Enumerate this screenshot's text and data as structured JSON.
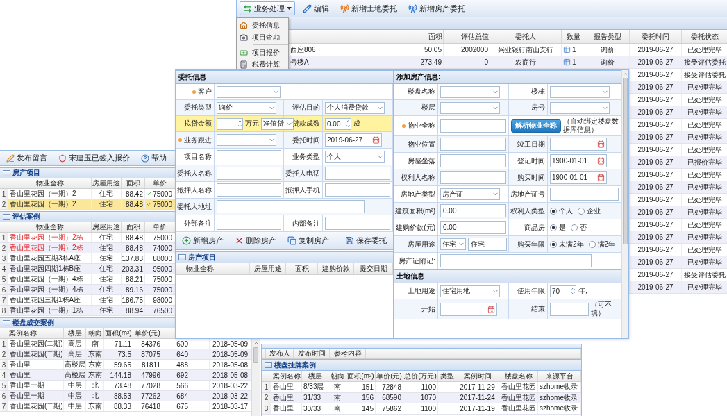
{
  "main_window": {
    "toolbar": [
      {
        "kind": "dropdown",
        "label": "业务处理"
      },
      {
        "kind": "edit",
        "label": "编辑"
      },
      {
        "kind": "land",
        "label": "新增土地委托"
      },
      {
        "kind": "house",
        "label": "新增房产委托"
      }
    ],
    "menu": [
      {
        "kind": "info",
        "label": "委托信息",
        "separator_before": false
      },
      {
        "kind": "survey",
        "label": "项目查勘",
        "separator_before": false
      },
      {
        "kind": "quote",
        "label": "项目报价",
        "separator_before": true
      },
      {
        "kind": "tax",
        "label": "税费计算",
        "separator_before": false
      }
    ],
    "columns": [
      "面积",
      "评估总值",
      "委托人",
      "数量",
      "报告类型",
      "委托时间",
      "委托状态"
    ],
    "rows": [
      {
        "name": "西座806",
        "area": "50.05",
        "value": "2002000",
        "client": "兴业银行南山支行",
        "count": "1",
        "report": "询价",
        "date": "2019-06-27",
        "status": "已处理完毕"
      },
      {
        "name": "号楼A",
        "area": "273.49",
        "value": "0",
        "client": "农商行",
        "count": "1",
        "report": "询价",
        "date": "2019-06-27",
        "status": "接受评估委托"
      },
      {
        "date": "2019-06-27",
        "status": "接受评估委托"
      },
      {
        "date": "2019-06-27",
        "status": "已处理完毕"
      },
      {
        "date": "2019-06-27",
        "status": "已处理完毕"
      },
      {
        "date": "2019-06-27",
        "status": "已处理完毕"
      },
      {
        "date": "2019-06-27",
        "status": "已处理完毕"
      },
      {
        "date": "2019-06-27",
        "status": "已处理完毕"
      },
      {
        "date": "2019-06-27",
        "status": "已处理完毕"
      },
      {
        "date": "2019-06-27",
        "status": "已报价完毕"
      },
      {
        "date": "2019-06-27",
        "status": "已处理完毕"
      },
      {
        "date": "2019-06-27",
        "status": "已处理完毕"
      },
      {
        "date": "2019-06-27",
        "status": "已处理完毕"
      },
      {
        "date": "2019-06-27",
        "status": "已处理完毕"
      },
      {
        "date": "2019-06-27",
        "status": "已处理完毕"
      },
      {
        "date": "2019-06-27",
        "status": "已处理完毕"
      },
      {
        "date": "2019-06-27",
        "status": "已处理完毕"
      },
      {
        "date": "2019-06-27",
        "status": "已处理完毕"
      },
      {
        "date": "2019-06-27",
        "status": "接受评估委托"
      },
      {
        "date": "2019-06-27",
        "status": "已处理完毕"
      }
    ]
  },
  "left_window": {
    "toolbar": [
      {
        "kind": "message",
        "label": "发布留言"
      },
      {
        "kind": "shield",
        "label": "宋建玉已签入报价"
      },
      {
        "kind": "help",
        "label": "帮助"
      }
    ],
    "property_items": {
      "title": "房产项目",
      "columns": [
        "物业全称",
        "房屋用途",
        "面积",
        "单价"
      ],
      "rows": [
        {
          "index": "1",
          "name": "香山里花园（一期）2",
          "use": "住宅",
          "area": "88.42",
          "verified": true,
          "price": "75000",
          "selected": false
        },
        {
          "index": "2",
          "name": "香山里花园（一期）2",
          "use": "住宅",
          "area": "88.48",
          "verified": true,
          "price": "75000",
          "selected": true
        }
      ]
    },
    "valuation_cases": {
      "title": "评估案例",
      "columns": [
        "物业全称",
        "房屋用途",
        "面积",
        "单价"
      ],
      "rows": [
        {
          "index": "1",
          "name": "香山里花园（一期）2栋",
          "use": "住宅",
          "area": "88.48",
          "price": "75000",
          "highlighted": true
        },
        {
          "index": "2",
          "name": "香山里花园（一期）2栋",
          "use": "住宅",
          "area": "88.48",
          "price": "74000",
          "highlighted": true
        },
        {
          "index": "3",
          "name": "香山里花园五期3栋A座",
          "use": "住宅",
          "area": "137.83",
          "price": "88000",
          "highlighted": false
        },
        {
          "index": "4",
          "name": "香山里花园四期1栋B座",
          "use": "住宅",
          "area": "203.31",
          "price": "95000",
          "highlighted": false
        },
        {
          "index": "5",
          "name": "香山里花园（一期）4栋",
          "use": "住宅",
          "area": "88.21",
          "price": "75000",
          "highlighted": false
        },
        {
          "index": "6",
          "name": "香山里花园（一期）4栋",
          "use": "住宅",
          "area": "89.16",
          "price": "75000",
          "highlighted": false
        },
        {
          "index": "7",
          "name": "香山里花园三期1栋A座",
          "use": "住宅",
          "area": "186.75",
          "price": "98000",
          "highlighted": false
        },
        {
          "index": "8",
          "name": "香山里花园（一期）1栋",
          "use": "住宅",
          "area": "88.94",
          "price": "76500",
          "highlighted": false
        }
      ]
    },
    "deal_cases": {
      "title": "楼盘成交案例",
      "columns": [
        "案例名称",
        "楼层",
        "朝向",
        "面积(m²)",
        "单价(元)"
      ],
      "rows": [
        {
          "index": "1",
          "name": "香山里花园(二期)",
          "floor": "高层",
          "facing": "南",
          "area": "71.11",
          "price": "84376",
          "total": "600",
          "date": "2018-05-09"
        },
        {
          "index": "2",
          "name": "香山里花园(二期)",
          "floor": "高层",
          "facing": "东南",
          "area": "73.5",
          "price": "87075",
          "total": "640",
          "date": "2018-05-09"
        },
        {
          "index": "3",
          "name": "香山里",
          "floor": "高楼层",
          "facing": "东南",
          "area": "59.65",
          "price": "81811",
          "total": "488",
          "date": "2018-05-08"
        },
        {
          "index": "4",
          "name": "香山里",
          "floor": "高楼层",
          "facing": "东南",
          "area": "144.18",
          "price": "47996",
          "total": "692",
          "date": "2018-05-08"
        },
        {
          "index": "5",
          "name": "香山里一期",
          "floor": "中层",
          "facing": "北",
          "area": "73.48",
          "price": "77028",
          "total": "566",
          "date": "2018-03-22"
        },
        {
          "index": "6",
          "name": "香山里一期",
          "floor": "中层",
          "facing": "北",
          "area": "88.53",
          "price": "77262",
          "total": "684",
          "date": "2018-03-22"
        },
        {
          "index": "7",
          "name": "香山里花园(二期)",
          "floor": "中层",
          "facing": "东南",
          "area": "88.33",
          "price": "76418",
          "total": "675",
          "date": "2018-03-17"
        }
      ]
    }
  },
  "dialog": {
    "entrust": {
      "title": "委托信息",
      "rows": [
        {
          "highlight": false,
          "cells": [
            {
              "label": "客户",
              "required": true,
              "fields": [
                {
                  "kind": "select"
                }
              ]
            }
          ]
        },
        {
          "highlight": false,
          "cells": [
            {
              "label": "委托类型",
              "required": false,
              "fields": [
                {
                  "kind": "select",
                  "value": "询价"
                }
              ]
            },
            {
              "label": "评估目的",
              "required": false,
              "fields": [
                {
                  "kind": "select",
                  "value": "个人消费贷款"
                }
              ]
            }
          ]
        },
        {
          "highlight": true,
          "cells": [
            {
              "label": "拟贷金额",
              "required": false,
              "fields": [
                {
                  "kind": "spinner"
                },
                {
                  "kind": "text",
                  "value": "万元"
                },
                {
                  "kind": "select",
                  "value": "净值贷"
                }
              ]
            },
            {
              "label": "贷款成数",
              "required": false,
              "fields": [
                {
                  "kind": "spinner",
                  "value": "0.00"
                },
                {
                  "kind": "text",
                  "value": "成"
                }
              ]
            }
          ]
        },
        {
          "highlight": false,
          "cells": [
            {
              "label": "业务跟进",
              "required": true,
              "fields": [
                {
                  "kind": "select"
                }
              ]
            },
            {
              "label": "委托时间",
              "required": false,
              "fields": [
                {
                  "kind": "date",
                  "value": "2019-06-27"
                }
              ]
            }
          ]
        },
        {
          "highlight": false,
          "cells": [
            {
              "label": "项目名称",
              "required": false,
              "fields": [
                {
                  "kind": "input"
                }
              ]
            },
            {
              "label": "业务类型",
              "required": false,
              "fields": [
                {
                  "kind": "select",
                  "value": "个人"
                }
              ]
            }
          ]
        },
        {
          "highlight": false,
          "cells": [
            {
              "label": "委托人名称",
              "required": false,
              "fields": [
                {
                  "kind": "input"
                }
              ]
            },
            {
              "label": "委托人电话",
              "required": false,
              "fields": [
                {
                  "kind": "input"
                }
              ]
            }
          ]
        },
        {
          "highlight": false,
          "cells": [
            {
              "label": "抵押人名称",
              "required": false,
              "fields": [
                {
                  "kind": "input"
                }
              ]
            },
            {
              "label": "抵押人手机",
              "required": false,
              "fields": [
                {
                  "kind": "input"
                }
              ]
            }
          ]
        },
        {
          "highlight": false,
          "cells": [
            {
              "label": "委托人地址",
              "required": false,
              "fields": [
                {
                  "kind": "input"
                }
              ]
            }
          ]
        },
        {
          "highlight": false,
          "cells": [
            {
              "label": "外部备注",
              "required": false,
              "fields": [
                {
                  "kind": "input"
                }
              ]
            },
            {
              "label": "内部备注",
              "required": false,
              "fields": [
                {
                  "kind": "input"
                }
              ]
            }
          ]
        }
      ],
      "toolbar": [
        {
          "kind": "add",
          "label": "新增房产"
        },
        {
          "kind": "delete",
          "label": "删除房产"
        },
        {
          "kind": "copy",
          "label": "复制房产"
        },
        {
          "kind": "save",
          "label": "保存委托"
        }
      ],
      "property_list": {
        "title": "房产项目",
        "columns": [
          "物业全称",
          "房屋用途",
          "面积",
          "建购价款",
          "提交日期"
        ]
      }
    },
    "property": {
      "sections": [
        {
          "title": "添加房产信息:",
          "rows": [
            {
              "cells": [
                {
                  "label": "楼盘名称",
                  "required": false,
                  "fields": [
                    {
                      "kind": "select"
                    }
                  ]
                },
                {
                  "label": "楼栋",
                  "required": false,
                  "fields": [
                    {
                      "kind": "select"
                    }
                  ]
                }
              ]
            },
            {
              "cells": [
                {
                  "label": "楼层",
                  "required": false,
                  "fields": [
                    {
                      "kind": "select"
                    }
                  ]
                },
                {
                  "label": "房号",
                  "required": false,
                  "fields": [
                    {
                      "kind": "select"
                    }
                  ]
                }
              ]
            },
            {
              "cells": [
                {
                  "label": "物业全称",
                  "required": true,
                  "fields": [
                    {
                      "kind": "input"
                    }
                  ]
                },
                {
                  "fields": [
                    {
                      "kind": "button",
                      "value": "解析物业全称"
                    },
                    {
                      "kind": "note",
                      "value": "（自动绑定楼盘数据库信息）"
                    }
                  ]
                }
              ]
            },
            {
              "cells": [
                {
                  "label": "物业位置",
                  "required": false,
                  "fields": [
                    {
                      "kind": "input"
                    }
                  ]
                },
                {
                  "label": "竣工日期",
                  "required": false,
                  "fields": [
                    {
                      "kind": "date"
                    }
                  ]
                }
              ]
            },
            {
              "cells": [
                {
                  "label": "房屋坐落",
                  "required": false,
                  "fields": [
                    {
                      "kind": "input"
                    }
                  ]
                },
                {
                  "label": "登记时间",
                  "required": false,
                  "fields": [
                    {
                      "kind": "date",
                      "value": "1900-01-01"
                    }
                  ]
                }
              ]
            },
            {
              "cells": [
                {
                  "label": "权利人名称",
                  "required": false,
                  "fields": [
                    {
                      "kind": "input"
                    }
                  ]
                },
                {
                  "label": "购买时间",
                  "required": false,
                  "fields": [
                    {
                      "kind": "date",
                      "value": "1900-01-01"
                    }
                  ]
                }
              ]
            },
            {
              "cells": [
                {
                  "label": "房地产类型",
                  "required": false,
                  "fields": [
                    {
                      "kind": "select",
                      "value": "房产证"
                    }
                  ]
                },
                {
                  "label": "房地产证号",
                  "required": false,
                  "fields": [
                    {
                      "kind": "input"
                    }
                  ]
                }
              ]
            },
            {
              "cells": [
                {
                  "label": "建筑面积(m²)",
                  "required": false,
                  "fields": [
                    {
                      "kind": "input",
                      "value": "0.00"
                    }
                  ]
                },
                {
                  "label": "权利人类型",
                  "required": false,
                  "fields": [
                    {
                      "kind": "radio",
                      "label": "个人",
                      "selected": true
                    },
                    {
                      "kind": "radio",
                      "label": "企业",
                      "selected": false
                    }
                  ]
                }
              ]
            },
            {
              "cells": [
                {
                  "label": "建购价款(元)",
                  "required": false,
                  "fields": [
                    {
                      "kind": "input",
                      "value": "0.00"
                    }
                  ]
                },
                {
                  "label": "商品房",
                  "required": false,
                  "fields": [
                    {
                      "kind": "radio",
                      "label": "是",
                      "selected": true
                    },
                    {
                      "kind": "radio",
                      "label": "否",
                      "selected": false
                    }
                  ]
                }
              ]
            },
            {
              "cells": [
                {
                  "label": "房屋用途",
                  "required": false,
                  "fields": [
                    {
                      "kind": "select",
                      "value": "住宅"
                    },
                    {
                      "kind": "input",
                      "value": "住宅"
                    }
                  ]
                },
                {
                  "label": "购买年限",
                  "required": false,
                  "fields": [
                    {
                      "kind": "radio",
                      "label": "未满2年",
                      "selected": true
                    },
                    {
                      "kind": "radio",
                      "label": "满2年",
                      "selected": false
                    }
                  ]
                }
              ]
            },
            {
              "cells": [
                {
                  "label": "房产证附记:",
                  "required": false,
                  "fields": [
                    {
                      "kind": "input"
                    }
                  ]
                }
              ]
            }
          ]
        },
        {
          "title": "土地信息",
          "rows": [
            {
              "cells": [
                {
                  "label": "土地用途",
                  "required": false,
                  "fields": [
                    {
                      "kind": "select",
                      "value": "住宅用地"
                    }
                  ]
                },
                {
                  "label": "使用年限",
                  "required": false,
                  "fields": [
                    {
                      "kind": "spinner",
                      "value": "70"
                    },
                    {
                      "kind": "text",
                      "value": "年,"
                    }
                  ]
                }
              ]
            },
            {
              "cells": [
                {
                  "label": "开始",
                  "required": false,
                  "fields": [
                    {
                      "kind": "date"
                    }
                  ]
                },
                {
                  "label": "结束",
                  "required": false,
                  "fields": [
                    {
                      "kind": "input"
                    },
                    {
                      "kind": "note",
                      "value": "（可不填）"
                    }
                  ]
                }
              ]
            }
          ]
        }
      ]
    }
  },
  "listing_window": {
    "message_columns": [
      "发布人",
      "发布时间",
      "参考内容"
    ],
    "listing_cases": {
      "title": "楼盘挂牌案例",
      "columns": [
        "案例名称",
        "楼层",
        "朝向",
        "面积(m²)",
        "单价(元)",
        "总价(万元)",
        "类型",
        "案例时间",
        "楼盘名称",
        "来源平台"
      ],
      "rows": [
        {
          "index": "1",
          "name": "香山里",
          "floor": "8/33层",
          "facing": "南",
          "area": "151",
          "price": "72848",
          "total": "1100",
          "date": "2017-11-29",
          "estate": "香山里花园",
          "source": "szhome收录"
        },
        {
          "index": "2",
          "name": "香山里",
          "floor": "31/33",
          "facing": "南",
          "area": "156",
          "price": "68590",
          "total": "1070",
          "date": "2017-11-24",
          "estate": "香山里花园",
          "source": "szhome收录"
        },
        {
          "index": "3",
          "name": "香山里",
          "floor": "30/33",
          "facing": "南",
          "area": "145",
          "price": "75862",
          "total": "1100",
          "date": "2017-11-19",
          "estate": "香山里花园",
          "source": "szhome收录"
        }
      ]
    }
  }
}
